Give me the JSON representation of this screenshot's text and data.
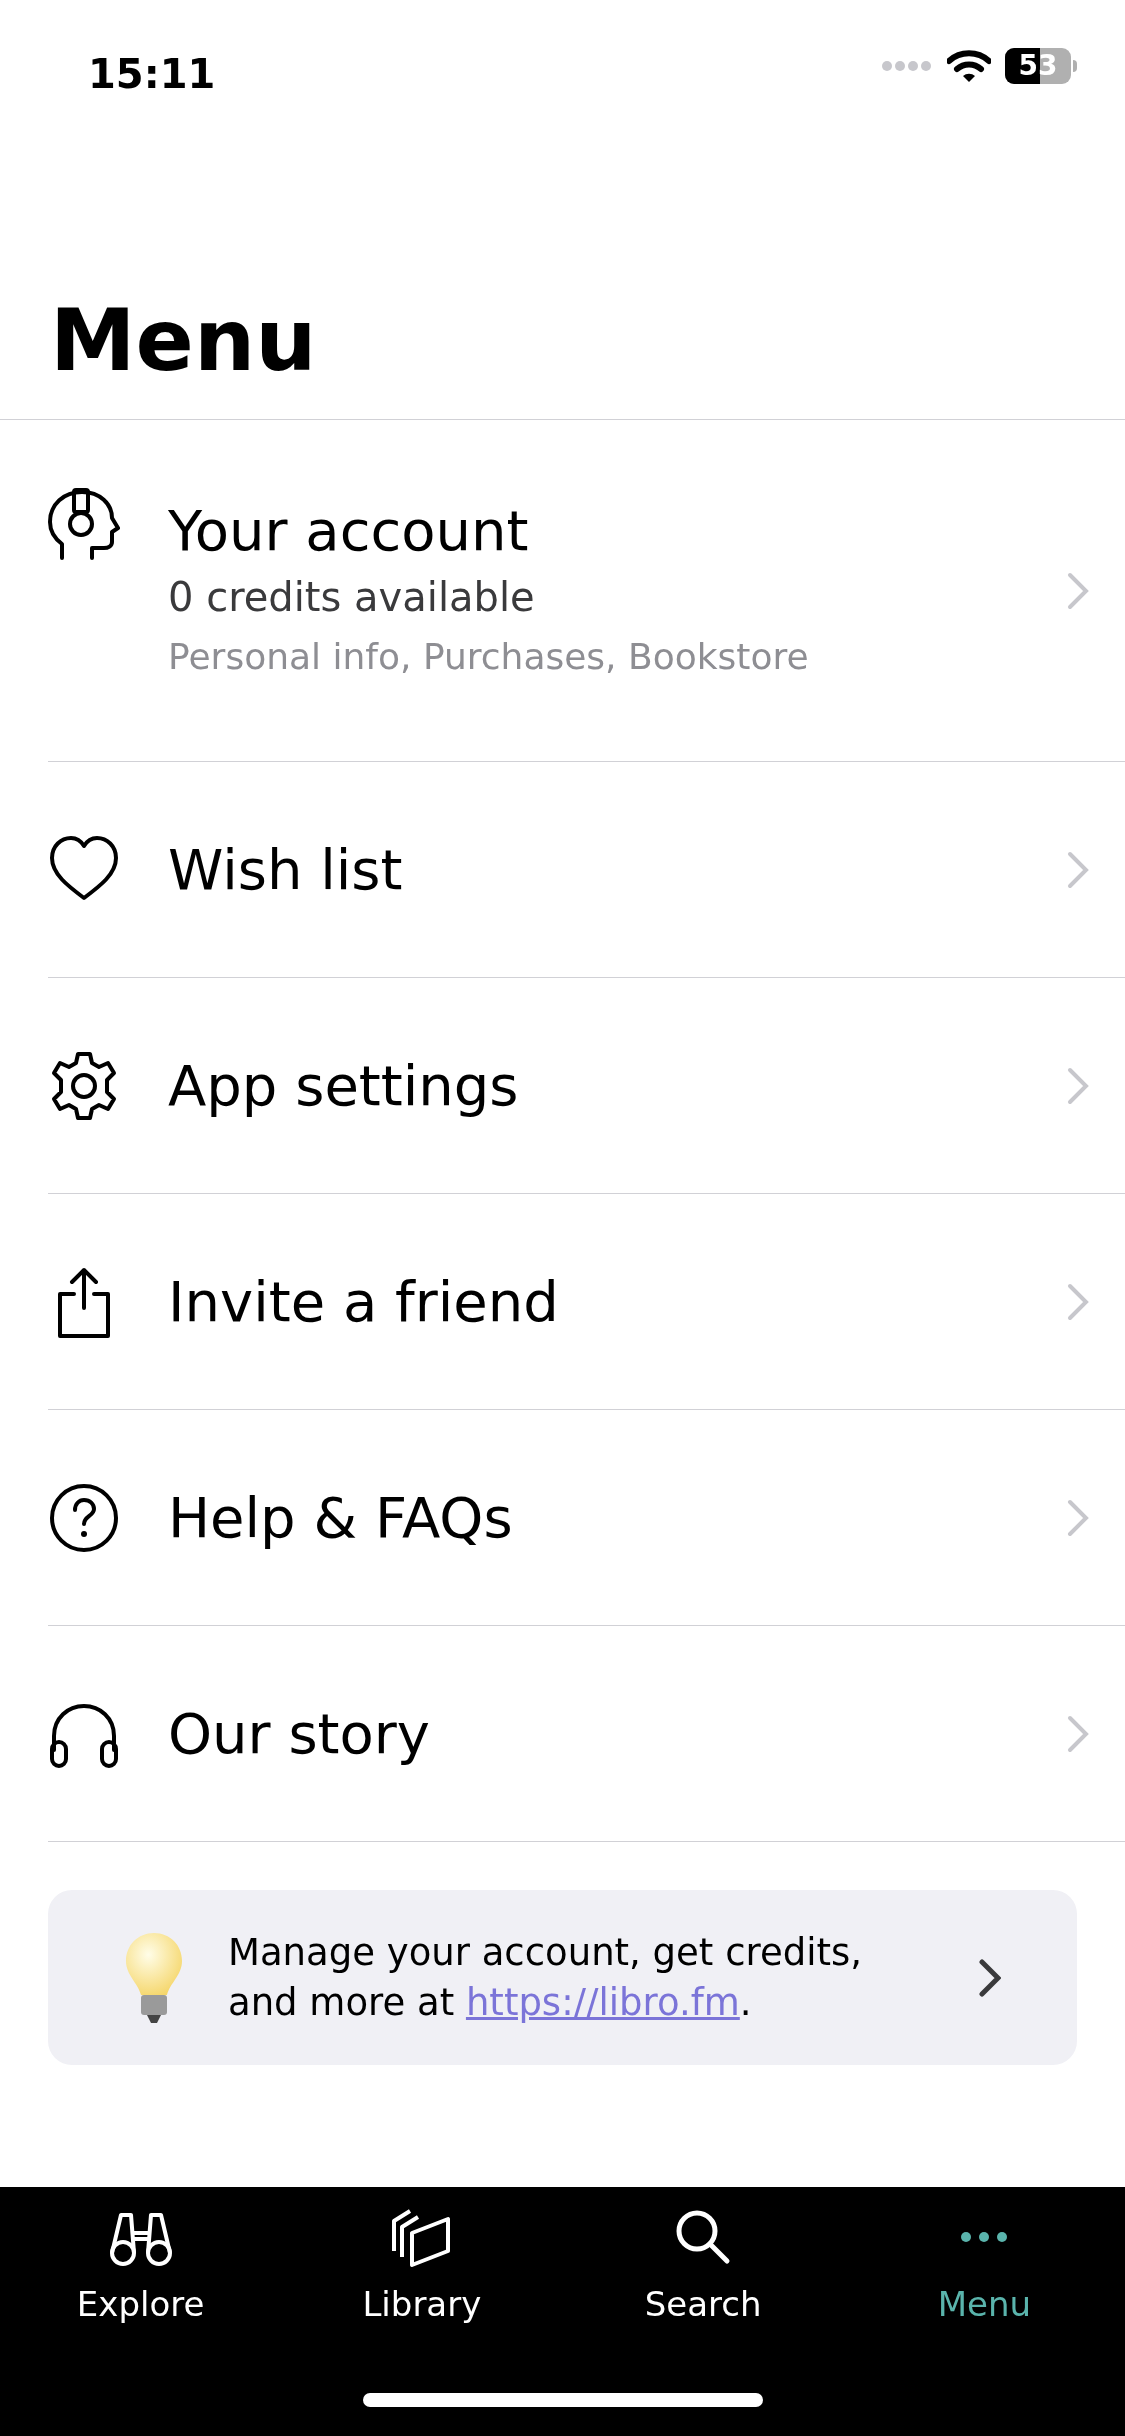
{
  "status_bar": {
    "time": "15:11",
    "battery": "53"
  },
  "title": "Menu",
  "account": {
    "title": "Your account",
    "credits": "0 credits available",
    "details": "Personal info, Purchases, Bookstore"
  },
  "items": [
    {
      "label": "Wish list"
    },
    {
      "label": "App settings"
    },
    {
      "label": "Invite a friend"
    },
    {
      "label": "Help & FAQs"
    },
    {
      "label": "Our story"
    }
  ],
  "banner": {
    "text_before": "Manage your account, get credits, and more at ",
    "link": "https://libro.fm",
    "text_after": "."
  },
  "tabs": [
    {
      "label": "Explore",
      "selected": false
    },
    {
      "label": "Library",
      "selected": false
    },
    {
      "label": "Search",
      "selected": false
    },
    {
      "label": "Menu",
      "selected": true
    }
  ]
}
